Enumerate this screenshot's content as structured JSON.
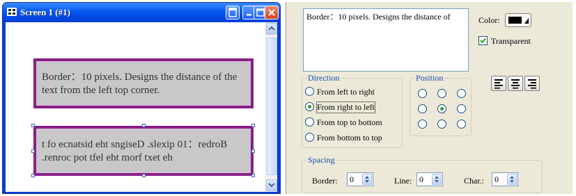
{
  "window": {
    "title": "Screen 1 (#1)",
    "accent": "#0a5cf0",
    "close_color": "#d9411d"
  },
  "canvas": {
    "box1_text": "Border：10 pixels. Designs the distance of the text from the left top corner.",
    "box2_text": "t fo ecnatsid eht sngiseD .slexip 01：redroB .renroc pot tfel eht morf txet eh",
    "border_color": "#8a1f8a",
    "box_fill": "#c8c8c8"
  },
  "panel": {
    "preview_text": "Border：10 pixels. Designs the distance of",
    "color_label": "Color:",
    "color_value": "#000000",
    "transparent_label": "Transparent",
    "transparent_checked": true,
    "direction": {
      "label": "Direction",
      "options": [
        "From left to right",
        "From right to left",
        "From top to bottom",
        "From bottom to top"
      ],
      "selected": "From right to left"
    },
    "position": {
      "label": "Position",
      "selected": "center"
    },
    "align_buttons": [
      "align-left",
      "align-center",
      "align-right"
    ],
    "spacing": {
      "label": "Spacing",
      "border_label": "Border:",
      "border_value": "0",
      "line_label": "Line:",
      "line_value": "0",
      "char_label": "Char.:",
      "char_value": "0"
    }
  }
}
